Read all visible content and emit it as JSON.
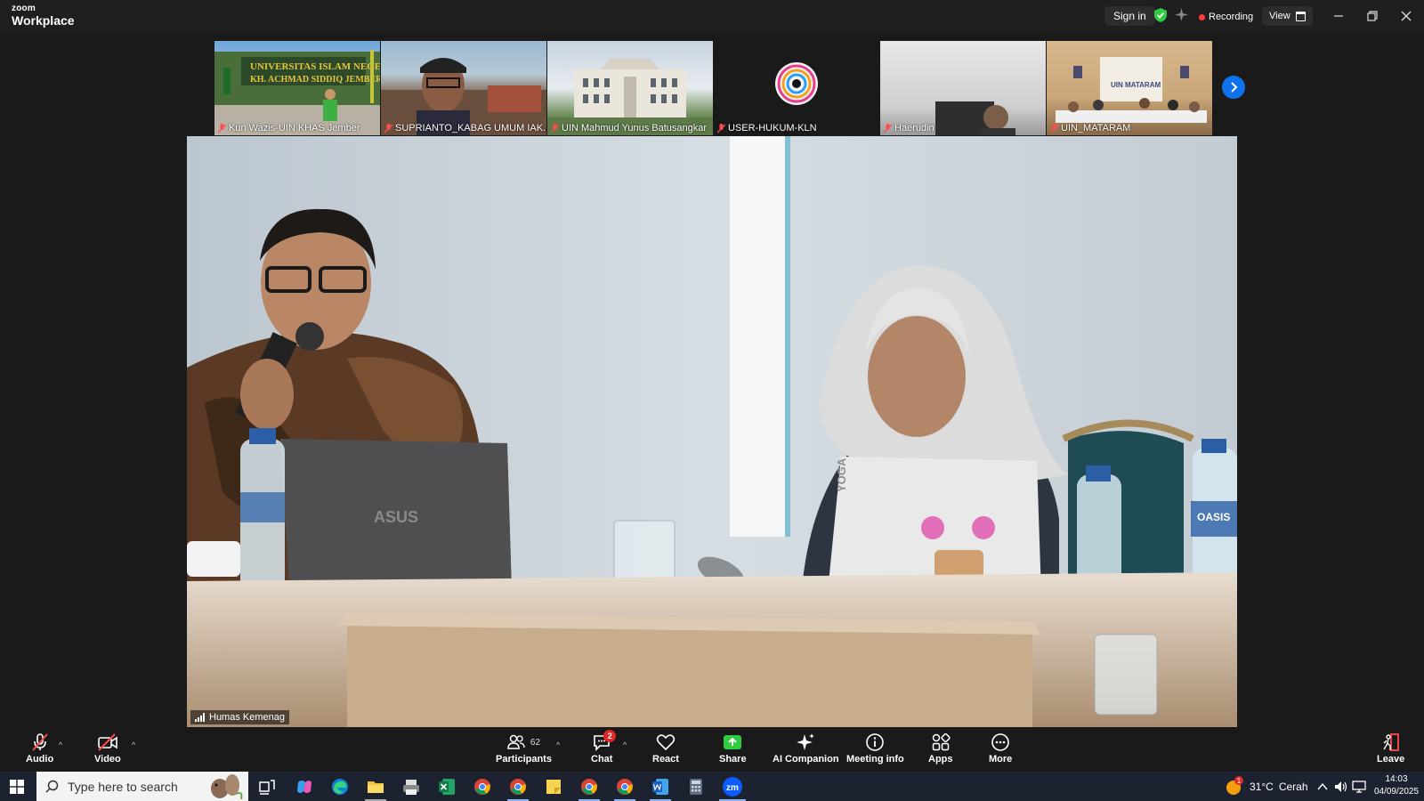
{
  "app": {
    "brand_small": "zoom",
    "brand_big": "Workplace"
  },
  "titlebar": {
    "sign_in": "Sign in",
    "recording": "Recording",
    "view": "View",
    "colors": {
      "shield": "#2ecc40",
      "rec": "#ff3b3b"
    }
  },
  "thumbnails": [
    {
      "name": "Kun Wazis-UIN KHAS Jember",
      "sign_text": "UNIVERSITAS ISLAM NEGERI",
      "sign_text2": "KH. ACHMAD SIDDIQ JEMBER"
    },
    {
      "name": "SUPRIANTO_KABAG UMUM IAK..."
    },
    {
      "name": "UIN Mahmud Yunus Batusangkar"
    },
    {
      "name": "USER-HUKUM-KLN"
    },
    {
      "name": "Haerudin"
    },
    {
      "name": "UIN_MATARAM",
      "banner": "UIN MATARAM"
    }
  ],
  "main_video": {
    "speaker": "Humas Kemenag",
    "laptop_left_brand": "ASUS",
    "laptop_right_brand": "YOGA",
    "bottle_brand": "OASIS"
  },
  "toolbar": {
    "audio": "Audio",
    "video": "Video",
    "participants": "Participants",
    "participants_count": "62",
    "chat": "Chat",
    "chat_badge": "2",
    "react": "React",
    "share": "Share",
    "ai_companion": "AI Companion",
    "meeting_info": "Meeting info",
    "apps": "Apps",
    "more": "More",
    "leave": "Leave",
    "colors": {
      "share": "#2ecc40",
      "muted": "#ff4d4d",
      "leave": "#ff4d4d"
    }
  },
  "taskbar": {
    "search_placeholder": "Type here to search",
    "weather_temp": "31°C",
    "weather_desc": "Cerah",
    "weather_badge": "1",
    "time": "14:03",
    "date": "04/09/2025"
  }
}
